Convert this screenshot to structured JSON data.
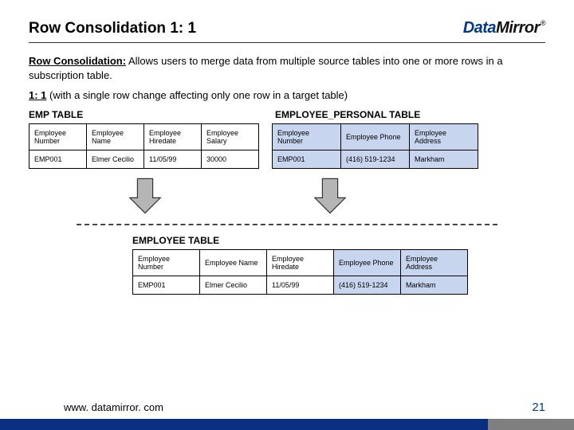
{
  "header": {
    "title": "Row Consolidation 1: 1",
    "logo_left": "Data",
    "logo_right": "Mirror",
    "logo_mark": "®"
  },
  "intro": {
    "label": "Row Consolidation:",
    "text": " Allows users to merge data from multiple source tables into one or more rows in a subscription table."
  },
  "oneone": {
    "label": "1: 1",
    "text": " (with a single row change affecting only one row in a target table)"
  },
  "tables": {
    "emp": {
      "title": "EMP TABLE",
      "head": [
        "Employee Number",
        "Employee Name",
        "Employee Hiredate",
        "Employee Salary"
      ],
      "row": [
        "EMP001",
        "Elmer Cecilio",
        "11/05/99",
        "30000"
      ]
    },
    "pers": {
      "title": "EMPLOYEE_PERSONAL TABLE",
      "head": [
        "Employee Number",
        "Employee Phone",
        "Employee Address"
      ],
      "row": [
        "EMP001",
        "(416) 519-1234",
        "Markham"
      ]
    },
    "target": {
      "title": "EMPLOYEE TABLE",
      "head": [
        "Employee Number",
        "Employee Name",
        "Employee Hiredate",
        "Employee Phone",
        "Employee Address"
      ],
      "row": [
        "EMP001",
        "Elmer Cecilio",
        "11/05/99",
        "(416) 519-1234",
        "Markham"
      ]
    }
  },
  "footer": {
    "url": "www. datamirror. com",
    "page": "21"
  }
}
